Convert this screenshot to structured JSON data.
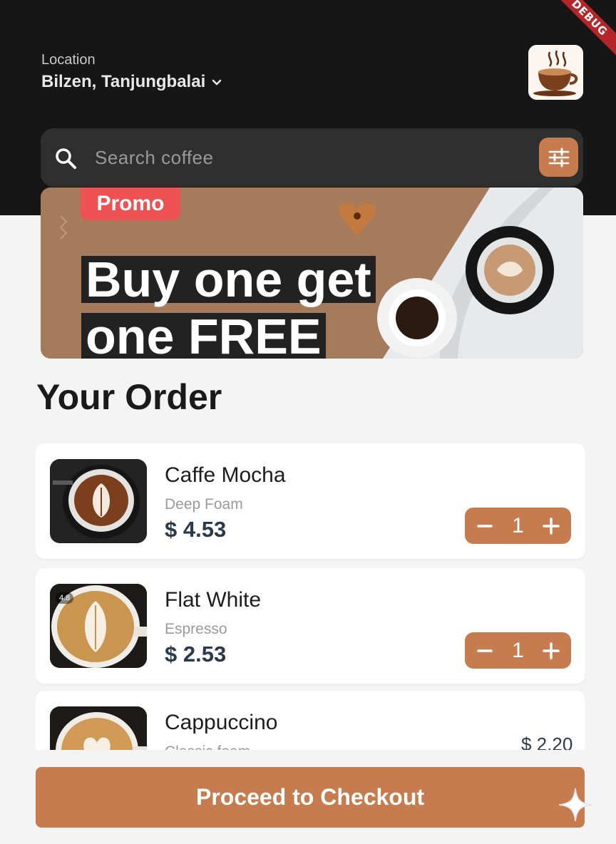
{
  "debug_banner": "DEBUG",
  "header": {
    "location_label": "Location",
    "location_value": "Bilzen, Tanjungbalai"
  },
  "search": {
    "placeholder": "Search coffee"
  },
  "promo": {
    "badge": "Promo",
    "line1": "Buy one get",
    "line2": "one FREE"
  },
  "order": {
    "title": "Your Order",
    "items": [
      {
        "name": "Caffe Mocha",
        "subtitle": "Deep Foam",
        "price": "$ 4.53",
        "quantity": "1",
        "decrease": "−",
        "increase": "+"
      },
      {
        "name": "Flat White",
        "subtitle": "Espresso",
        "price": "$ 2.53",
        "quantity": "1",
        "decrease": "−",
        "increase": "+",
        "rating": "4.8"
      },
      {
        "name": "Cappuccino",
        "subtitle": "Classic foam",
        "price": "$ 2.20"
      }
    ]
  },
  "checkout": {
    "label": "Proceed to Checkout"
  },
  "colors": {
    "accent": "#c67c4e",
    "dark": "#171616",
    "promo_badge": "#ed5151"
  }
}
